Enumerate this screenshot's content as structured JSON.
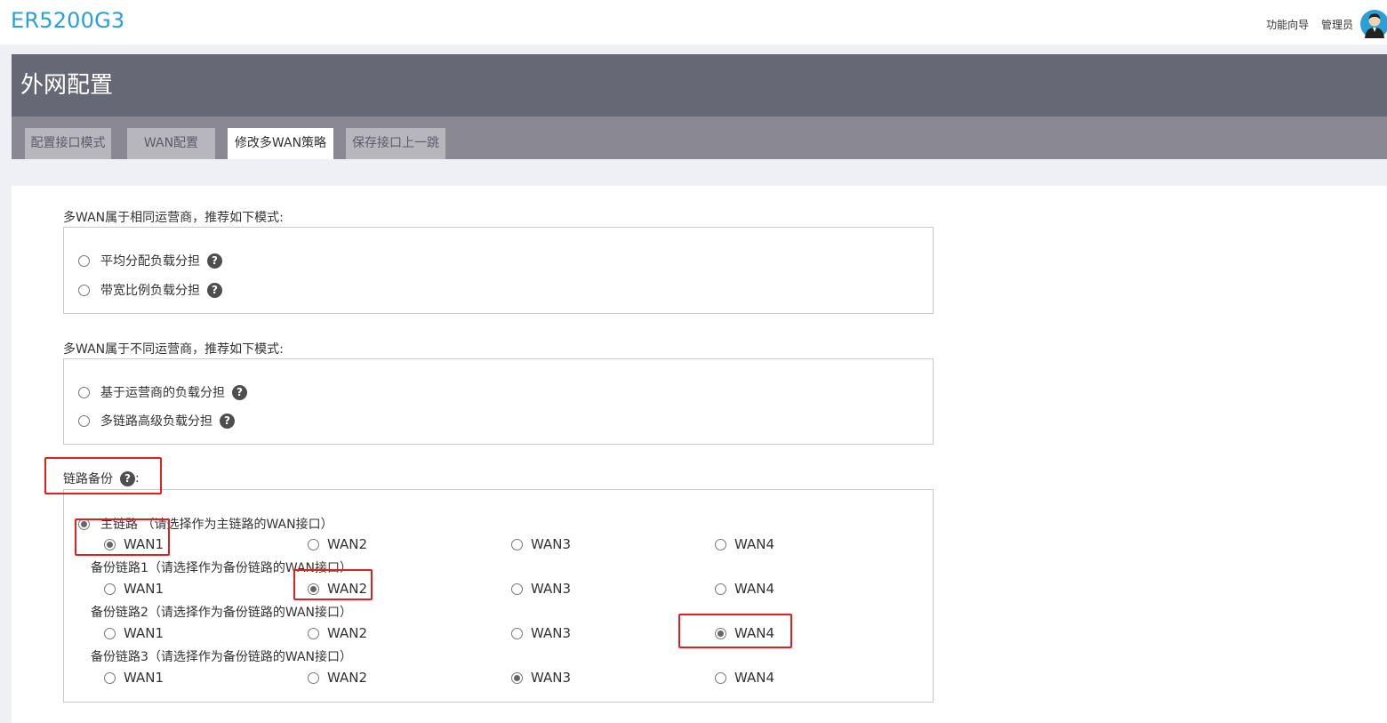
{
  "header": {
    "brand": "ER5200G3",
    "wizard_link": "功能向导",
    "admin_link": "管理员"
  },
  "panel": {
    "title": "外网配置",
    "tabs": [
      {
        "label": "配置接口模式",
        "active": false
      },
      {
        "label": "WAN配置",
        "active": false
      },
      {
        "label": "修改多WAN策略",
        "active": true
      },
      {
        "label": "保存接口上一跳",
        "active": false
      }
    ]
  },
  "same_isp": {
    "label": "多WAN属于相同运营商，推荐如下模式:",
    "options": [
      {
        "label": "平均分配负载分担",
        "checked": false
      },
      {
        "label": "带宽比例负载分担",
        "checked": false
      }
    ]
  },
  "diff_isp": {
    "label": "多WAN属于不同运营商，推荐如下模式:",
    "options": [
      {
        "label": "基于运营商的负载分担",
        "checked": false
      },
      {
        "label": "多链路高级负载分担",
        "checked": false
      }
    ]
  },
  "backup": {
    "label": "链路备份",
    "colon": ":",
    "main_option_label": "主链路 （请选择作为主链路的WAN接口）",
    "rows": [
      {
        "label": "主链路 （请选择作为主链路的WAN接口）",
        "selected": "WAN1"
      },
      {
        "label": "备份链路1（请选择作为备份链路的WAN接口）",
        "selected": "WAN2"
      },
      {
        "label": "备份链路2（请选择作为备份链路的WAN接口）",
        "selected": "WAN4"
      },
      {
        "label": "备份链路3（请选择作为备份链路的WAN接口）",
        "selected": "WAN3"
      }
    ],
    "wan_labels": [
      "WAN1",
      "WAN2",
      "WAN3",
      "WAN4"
    ]
  },
  "help_glyph": "?",
  "colors": {
    "brand": "#2a9fd8",
    "panel_header": "#666875",
    "tab_bar": "#8a8893",
    "highlight": "#e02020"
  }
}
